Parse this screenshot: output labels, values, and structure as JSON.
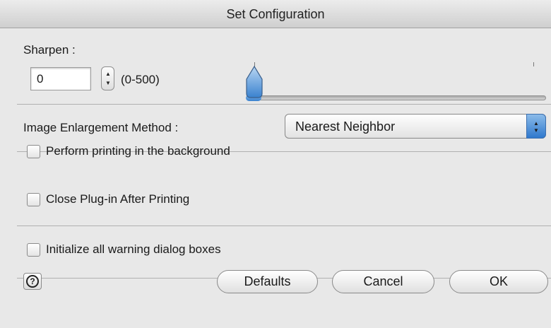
{
  "window": {
    "title": "Set Configuration"
  },
  "sharpen": {
    "label": "Sharpen :",
    "value": "0",
    "range_text": "(0-500)",
    "min": 0,
    "max": 500,
    "slider_value": 0
  },
  "enlargement": {
    "label": "Image Enlargement Method :",
    "selected": "Nearest Neighbor"
  },
  "options": {
    "background_printing": {
      "label": "Perform printing in the background",
      "checked": false
    },
    "close_plugin": {
      "label": "Close Plug-in After Printing",
      "checked": false
    },
    "init_warnings": {
      "label": "Initialize all warning dialog boxes",
      "checked": false
    }
  },
  "buttons": {
    "help_glyph": "?",
    "defaults": "Defaults",
    "cancel": "Cancel",
    "ok": "OK"
  },
  "colors": {
    "accent": "#3a82cf"
  }
}
